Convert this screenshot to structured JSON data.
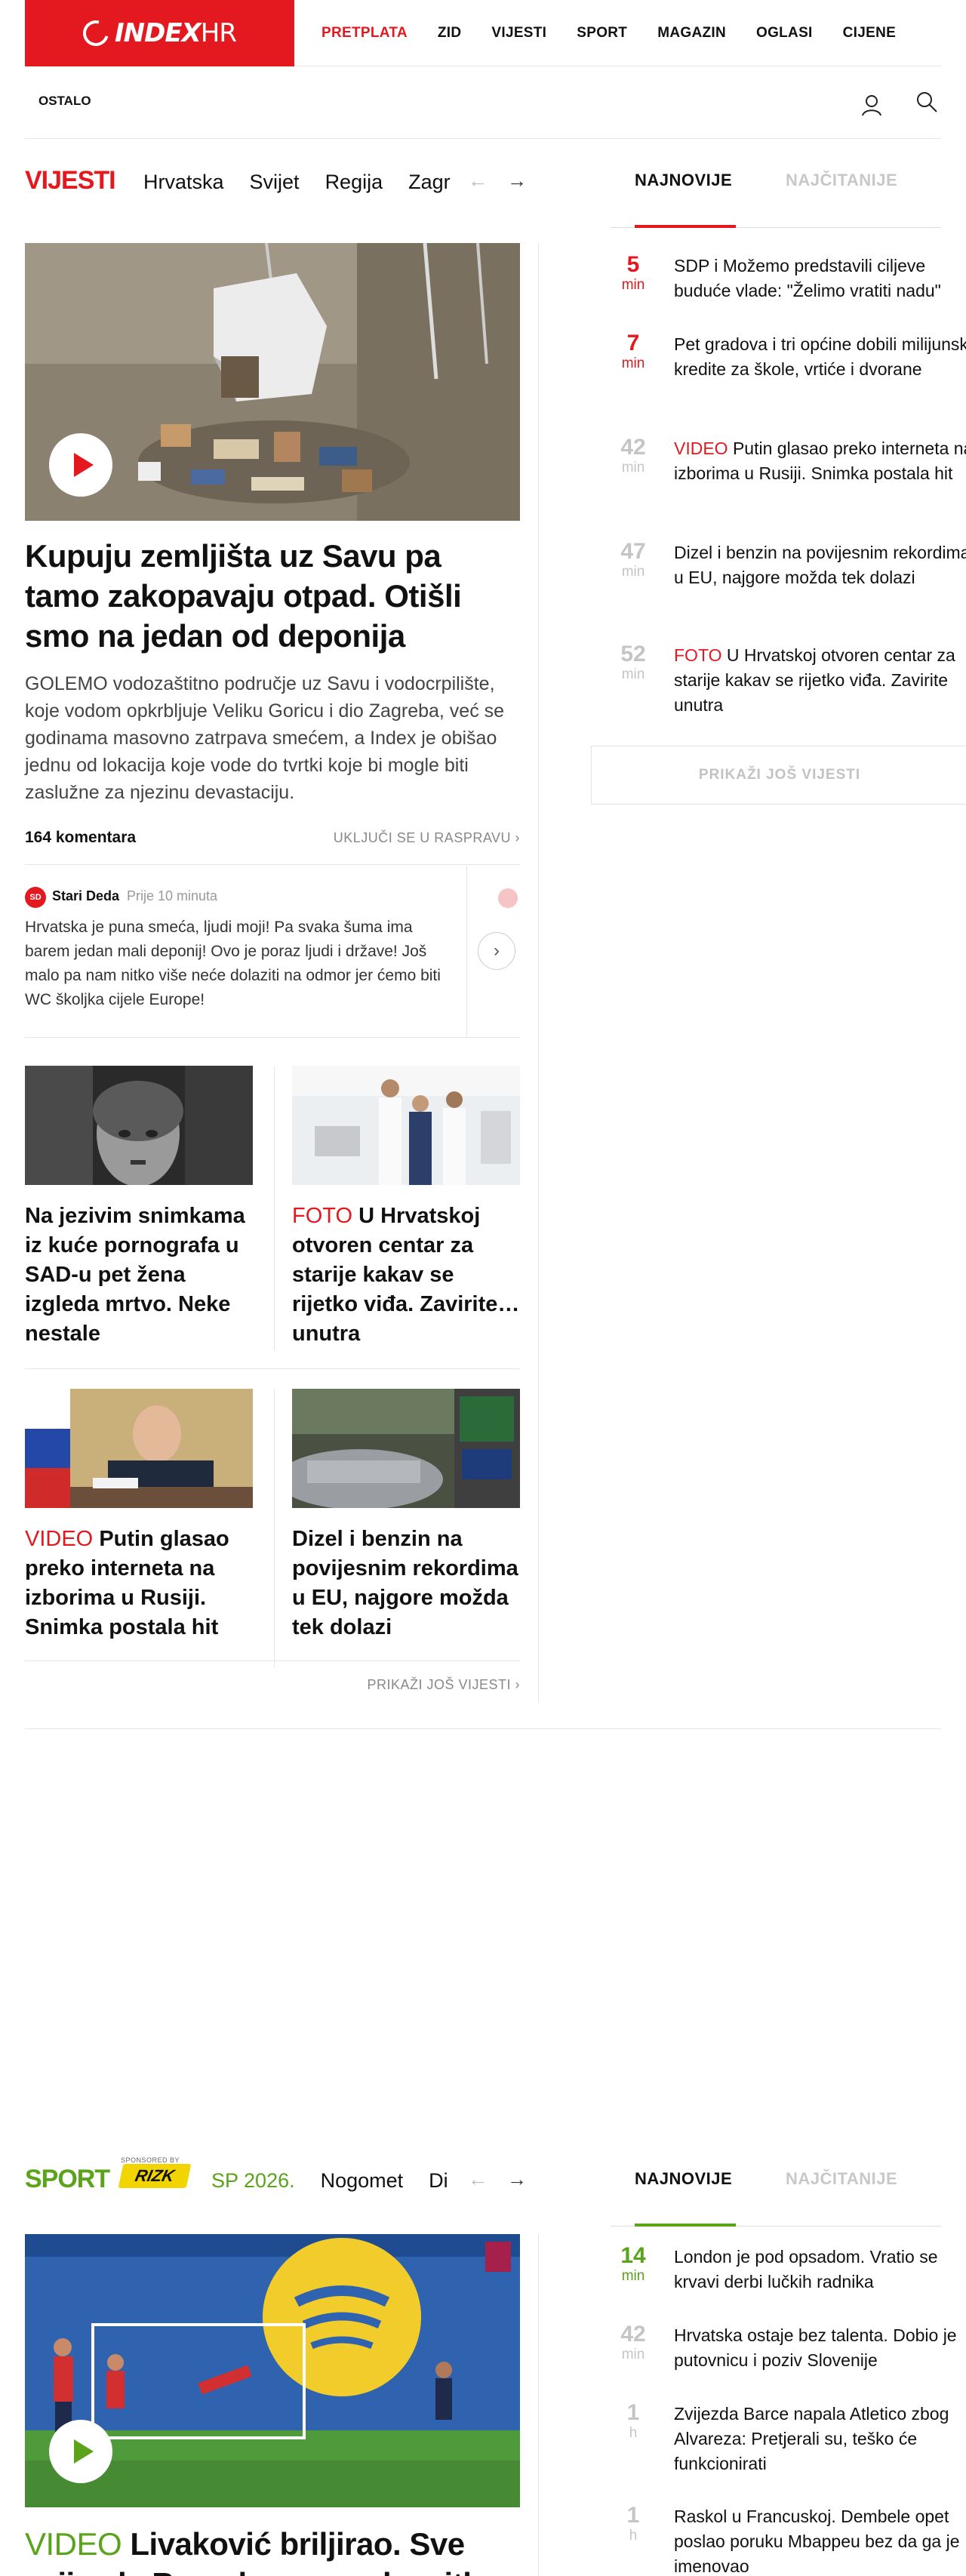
{
  "header": {
    "logo_text": "INDEX",
    "logo_suffix": "HR",
    "nav": [
      "PRETPLATA",
      "ZID",
      "VIJESTI",
      "SPORT",
      "MAGAZIN",
      "OGLASI",
      "CIJENE"
    ],
    "secondary": "OSTALO",
    "icons": [
      "user-icon",
      "search-icon"
    ]
  },
  "vijesti": {
    "section_title": "VIJESTI",
    "subnav": [
      "Hrvatska",
      "Svijet",
      "Regija",
      "Zagr"
    ],
    "tabs": [
      "NAJNOVIJE",
      "NAJČITANIJE"
    ],
    "lead": {
      "title": "Kupuju zemljišta uz Savu pa tamo zakopavaju otpad. Otišli smo na jedan od deponija",
      "summary": "GOLEMO vodozaštitno područje uz Savu i vodocrpilište, koje vodom opkrbljuje Veliku Goricu i dio Zagreba, već se godinama masovno zatrpava smećem, a Index je obišao jednu od lokacija koje vode do tvrtki koje bi mogle biti zaslužne za njezinu devastaciju.",
      "comments_count": "164 komentara",
      "join_label": "UKLJUČI SE U RASPRAVU ›"
    },
    "comment": {
      "initials": "SD",
      "author": "Stari Deda",
      "time": "Prije 10 minuta",
      "text": "Hrvatska je puna smeća, ljudi moji! Pa svaka šuma ima barem jedan mali deponij! Ovo je poraz ljudi i države! Još malo pa nam nitko više neće dolaziti na odmor jer ćemo biti WC školjka cijele Europe!"
    },
    "cards": [
      {
        "label": "",
        "title": "Na jezivim snimkama iz kuće pornografa u SAD-u pet žena izgleda mrtvo. Neke nestale"
      },
      {
        "label": "FOTO",
        "title": "U Hrvatskoj otvoren centar za starije kakav se rijetko viđa. Zavirite… unutra"
      },
      {
        "label": "VIDEO",
        "title": "Putin glasao preko interneta na izborima u Rusiji. Snimka postala hit"
      },
      {
        "label": "",
        "title": "Dizel i benzin na povijesnim rekordima u EU, najgore možda tek dolazi"
      }
    ],
    "more_link": "PRIKAŽI JOŠ VIJESTI ›",
    "latest": [
      {
        "num": "5",
        "unit": "min",
        "label": "",
        "text": "SDP i Možemo predstavili ciljeve buduće vlade: \"Želimo vratiti nadu\""
      },
      {
        "num": "7",
        "unit": "min",
        "label": "",
        "text": "Pet gradova i tri općine dobili milijunske kredite za škole, vrtiće i dvorane"
      },
      {
        "num": "42",
        "unit": "min",
        "label": "VIDEO",
        "text": "Putin glasao preko interneta na izborima u Rusiji. Snimka postala hit"
      },
      {
        "num": "47",
        "unit": "min",
        "label": "",
        "text": "Dizel i benzin na povijesnim rekordima u EU, najgore možda tek dolazi"
      },
      {
        "num": "52",
        "unit": "min",
        "label": "FOTO",
        "text": "U Hrvatskoj otvoren centar za starije kakav se rijetko viđa. Zavirite unutra"
      }
    ],
    "show_more": "PRIKAŽI JOŠ VIJESTI"
  },
  "sport": {
    "section_title": "SPORT",
    "sponsored_by": "SPONSORED BY",
    "sponsor": "RIZK",
    "subnav": [
      "SP 2026.",
      "Nogomet",
      "Di"
    ],
    "tabs": [
      "NAJNOVIJE",
      "NAJČITANIJE"
    ],
    "lead": {
      "label": "VIDEO",
      "title": "Livaković briljirao. Sve zvijezde Barcelone pucale, nitko"
    },
    "latest": [
      {
        "num": "14",
        "unit": "min",
        "text": "London je pod opsadom. Vratio se krvavi derbi lučkih radnika"
      },
      {
        "num": "42",
        "unit": "min",
        "text": "Hrvatska ostaje bez talenta. Dobio je putovnicu i poziv Slovenije"
      },
      {
        "num": "1",
        "unit": "h",
        "text": "Zvijezda Barce napala Atletico zbog Alvareza: Pretjerali su, teško će funkcionirati"
      },
      {
        "num": "1",
        "unit": "h",
        "text": "Raskol u Francuskoj. Dembele opet poslao poruku Mbappeu bez da ga je imenovao"
      }
    ]
  },
  "colors": {
    "brand_red": "#e3191f",
    "sport_green": "#5aa31a",
    "muted": "#c5c5c5"
  }
}
